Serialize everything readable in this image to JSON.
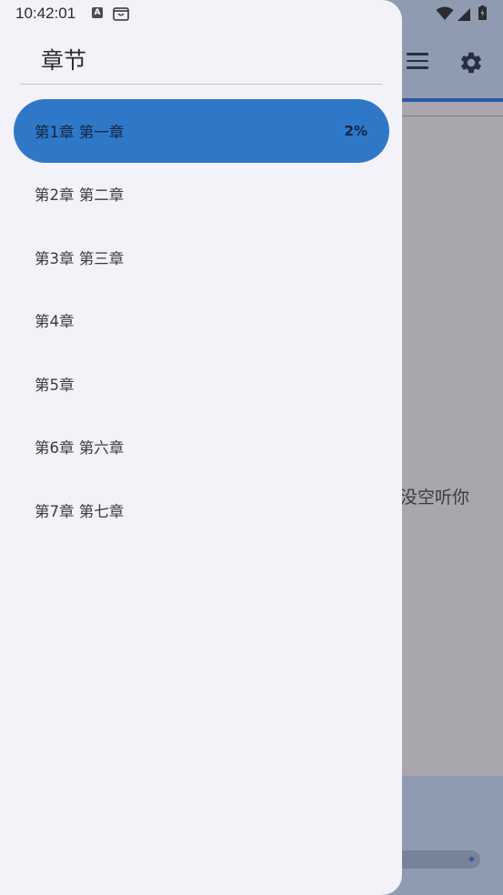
{
  "status_bar": {
    "time": "10:42:01",
    "a_icon_glyph": "A",
    "icons": [
      "a-notification-icon",
      "bag-notification-icon",
      "wifi-icon",
      "signal-icon",
      "battery-icon"
    ]
  },
  "background": {
    "body_text": "没空听你",
    "toolbar_icons": [
      "menu-icon",
      "gear-icon"
    ]
  },
  "drawer": {
    "title": "章节",
    "chapters": [
      {
        "label": "第1章 第一章",
        "progress": "2%",
        "active": true
      },
      {
        "label": "第2章 第二章",
        "progress": "",
        "active": false
      },
      {
        "label": "第3章 第三章",
        "progress": "",
        "active": false
      },
      {
        "label": "第4章",
        "progress": "",
        "active": false
      },
      {
        "label": "第5章",
        "progress": "",
        "active": false
      },
      {
        "label": "第6章 第六章",
        "progress": "",
        "active": false
      },
      {
        "label": "第7章 第七章",
        "progress": "",
        "active": false
      }
    ]
  },
  "colors": {
    "accent": "#2f78c8",
    "drawer_bg": "#f3f2f9",
    "scrim_bg": "#a9a6ad"
  }
}
